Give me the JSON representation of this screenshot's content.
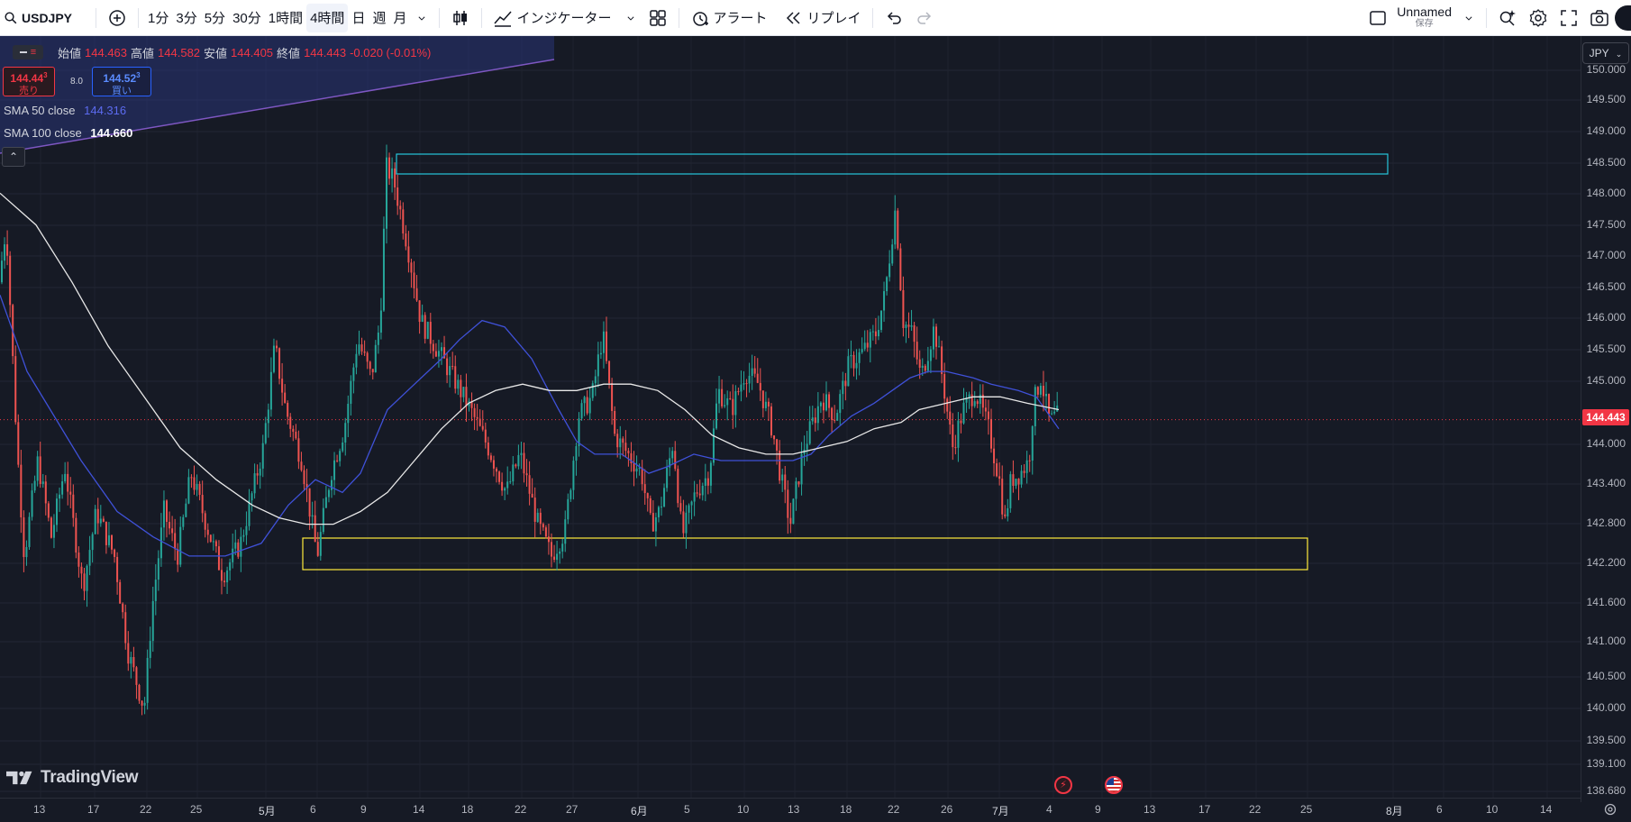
{
  "toolbar": {
    "symbol": "USDJPY",
    "intervals": [
      "1分",
      "3分",
      "5分",
      "30分",
      "1時間",
      "4時間",
      "日",
      "週",
      "月"
    ],
    "active_interval": "4時間",
    "indicators_label": "インジケーター",
    "alert_label": "アラート",
    "replay_label": "リプレイ",
    "layout_name": "Unnamed",
    "layout_sub": "保存"
  },
  "legend": {
    "open_label": "始値",
    "open": "144.463",
    "high_label": "高値",
    "high": "144.582",
    "low_label": "安値",
    "low": "144.405",
    "close_label": "終値",
    "close": "144.443",
    "change": "-0.020 (-0.01%)",
    "sell_price_main": "144.44",
    "sell_price_sup": "3",
    "sell_label": "売り",
    "spread": "8.0",
    "buy_price_main": "144.52",
    "buy_price_sup": "3",
    "buy_label": "買い",
    "sma50_label": "SMA 50 close",
    "sma50_value": "144.316",
    "sma100_label": "SMA 100 close",
    "sma100_value": "144.660"
  },
  "price_axis": {
    "currency": "JPY",
    "ticks": [
      "150.000",
      "149.500",
      "149.000",
      "148.500",
      "148.000",
      "147.500",
      "147.000",
      "146.500",
      "146.000",
      "145.500",
      "145.000",
      "144.000",
      "143.400",
      "142.800",
      "142.200",
      "141.600",
      "141.000",
      "140.500",
      "140.000",
      "139.500",
      "139.100",
      "138.680"
    ],
    "current_price": "144.443"
  },
  "time_axis": {
    "labels": [
      "13",
      "17",
      "22",
      "25",
      "5月",
      "6",
      "9",
      "14",
      "18",
      "22",
      "27",
      "6月",
      "5",
      "10",
      "13",
      "18",
      "22",
      "26",
      "7月",
      "4",
      "9",
      "13",
      "17",
      "22",
      "25",
      "8月",
      "6",
      "10",
      "14"
    ]
  },
  "brand": "TradingView",
  "colors": {
    "up": "#26a69a",
    "down": "#ef5350",
    "sma50": "#3f51d8",
    "sma100": "#e8e8e8",
    "zone_top": "#26c6da",
    "zone_bottom": "#ffeb3b"
  }
}
